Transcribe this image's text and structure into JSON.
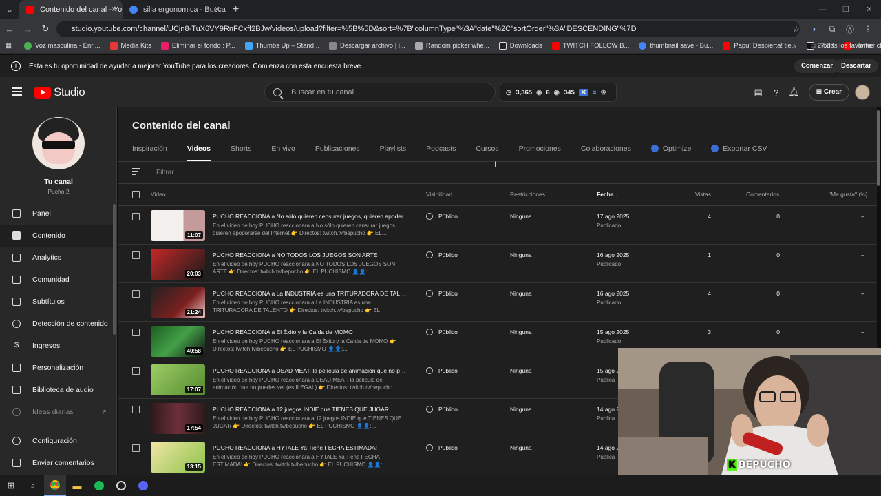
{
  "browser": {
    "tabs": [
      {
        "label": "Contenido del canal - YouTube",
        "active": true
      },
      {
        "label": "silla ergonomica - Buscar con G",
        "active": false
      }
    ],
    "url": "studio.youtube.com/channel/UCjn8-TuX6VY9RnFCxff2BJw/videos/upload?filter=%5B%5D&sort=%7B\"columnType\"%3A\"date\"%2C\"sortOrder\"%3A\"DESCENDING\"%7D",
    "bookmarks": [
      "Voz masculina - Enri...",
      "Media Kits",
      "Eliminar el fondo : P...",
      "Thumbs Up – Stand...",
      "Descargar archivo | i...",
      "Random picker whe...",
      "Downloads",
      "TWITCH FOLLOW B...",
      "thumbnail save - Bu...",
      "Papu! Despierta! tie...",
      "27.3K",
      "Homer changuito.3..."
    ],
    "bookmarks_all": "Todos los favoritos"
  },
  "banner": {
    "text": "Esta es tu oportunidad de ayudar a mejorar YouTube para los creadores. Comienza con esta encuesta breve.",
    "start": "Comenzar",
    "dismiss": "Descartar"
  },
  "header": {
    "logo": "Studio",
    "search_placeholder": "Buscar en tu canal",
    "stats": {
      "subs": "3,365",
      "views": "6",
      "other": "345"
    },
    "create": "Crear"
  },
  "sidebar": {
    "channel_label": "Tu canal",
    "channel_name": "Pucho 2",
    "items": [
      {
        "label": "Panel",
        "icon": "dashboard-icon"
      },
      {
        "label": "Contenido",
        "icon": "content-icon",
        "active": true
      },
      {
        "label": "Analytics",
        "icon": "analytics-icon"
      },
      {
        "label": "Comunidad",
        "icon": "community-icon"
      },
      {
        "label": "Subtítulos",
        "icon": "subtitles-icon"
      },
      {
        "label": "Detección de contenido",
        "icon": "copyright-icon"
      },
      {
        "label": "Ingresos",
        "icon": "earn-icon"
      },
      {
        "label": "Personalización",
        "icon": "customization-icon"
      },
      {
        "label": "Biblioteca de audio",
        "icon": "audio-library-icon"
      },
      {
        "label": "Ideas diarias",
        "icon": "ideas-icon"
      }
    ],
    "settings": "Configuración",
    "feedback": "Enviar comentarios"
  },
  "main": {
    "title": "Contenido del canal",
    "tabs": [
      "Inspiración",
      "Videos",
      "Shorts",
      "En vivo",
      "Publicaciones",
      "Playlists",
      "Podcasts",
      "Cursos",
      "Promociones",
      "Colaboraciones",
      "Optimize",
      "Exportar CSV"
    ],
    "filter": "Filtrar",
    "columns": {
      "video": "Video",
      "visibility": "Visibilidad",
      "restrictions": "Restricciones",
      "date": "Fecha",
      "views": "Vistas",
      "comments": "Comentarios",
      "likes": "\"Me gusta\" (%)"
    },
    "rows": [
      {
        "title": "PUCHO REACCIONA a No sólo quieren censurar juegos, quieren apoder...",
        "desc": "En el video de hoy PUCHO reaccionara a No sólo quieren censurar juegos, quieren apoderarse del Internet 👉 Directos: twitch.tv/bepucho 👉 EL...",
        "duration": "11:07",
        "visibility": "Público",
        "restrictions": "Ninguna",
        "date": "17 ago 2025",
        "status": "Publicado",
        "views": "4",
        "comments": "0",
        "likes": "–"
      },
      {
        "title": "PUCHO REACCIONA a NO TODOS LOS JUEGOS SON ARTE",
        "desc": "En el video de hoy PUCHO reaccionara a NO TODOS LOS JUEGOS SON ARTE 👉 Directos: twitch.tv/bepucho 👉 EL PUCHISMO 👤👤:...",
        "duration": "20:03",
        "visibility": "Público",
        "restrictions": "Ninguna",
        "date": "16 ago 2025",
        "status": "Publicado",
        "views": "1",
        "comments": "0",
        "likes": "–"
      },
      {
        "title": "PUCHO REACCIONA a La INDUSTRIA es una TRITURADORA DE TALENTO",
        "desc": "En el video de hoy PUCHO reaccionara a La INDUSTRIA es una TRITURADORA DE TALENTO 👉 Directos: twitch.tv/bepucho 👉 EL PUCHISMO 👤👤:...",
        "duration": "21:24",
        "visibility": "Público",
        "restrictions": "Ninguna",
        "date": "16 ago 2025",
        "status": "Publicado",
        "views": "4",
        "comments": "0",
        "likes": "–"
      },
      {
        "title": "PUCHO REACCIONA a El Éxito y la Caída de MOMO",
        "desc": "En el video de hoy PUCHO reaccionara a El Éxito y la Caída de MOMO 👉 Directos: twitch.tv/bepucho 👉 EL PUCHISMO 👤👤:...",
        "duration": "40:58",
        "visibility": "Público",
        "restrictions": "Ninguna",
        "date": "15 ago 2025",
        "status": "Publicado",
        "views": "3",
        "comments": "0",
        "likes": "–"
      },
      {
        "title": "PUCHO REACCIONA a DEAD MEAT: la película de animación que no pue...",
        "desc": "En el video de hoy PUCHO reaccionara a DEAD MEAT: la película de animación que no puedes ver (es ILEGAL) 👉 Directos: twitch.tv/bepucho ...",
        "duration": "17:07",
        "visibility": "Público",
        "restrictions": "Ninguna",
        "date": "15 ago 2",
        "status": "Publica",
        "views": "",
        "comments": "",
        "likes": ""
      },
      {
        "title": "PUCHO REACCIONA a 12 juegos INDIE que TIENES QUE JUGAR",
        "desc": "En el video de hoy PUCHO reaccionara a 12 juegos INDIE que TIENES QUE JUGAR 👉 Directos: twitch.tv/bepucho 👉 EL PUCHISMO 👤👤:...",
        "duration": "17:54",
        "visibility": "Público",
        "restrictions": "Ninguna",
        "date": "14 ago 2",
        "status": "Publica",
        "views": "",
        "comments": "",
        "likes": ""
      },
      {
        "title": "PUCHO REACCIONA a HYTALE Ya Tiene FECHA ESTIMADA!",
        "desc": "En el video de hoy PUCHO reaccionara a HYTALE Ya Tiene FECHA ESTIMADA! 👉 Directos: twitch.tv/bepucho 👉 EL PUCHISMO 👤👤:...",
        "duration": "13:15",
        "visibility": "Público",
        "restrictions": "Ninguna",
        "date": "14 ago 2",
        "status": "Publica",
        "views": "",
        "comments": "",
        "likes": ""
      }
    ]
  },
  "webcam": {
    "overlay_text": "BEPUCHO"
  }
}
